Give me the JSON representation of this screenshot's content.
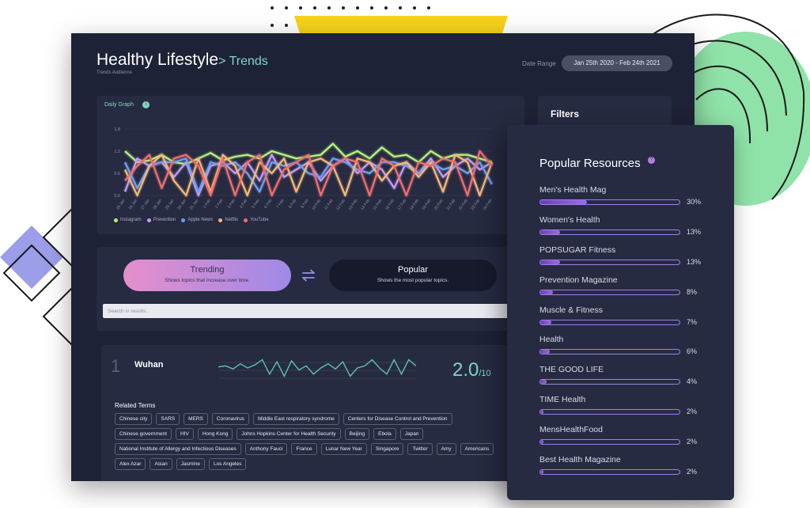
{
  "header": {
    "title": "Healthy Lifestyle",
    "crumb": "> Trends",
    "subtitle": "Trends Audience",
    "date_range_label": "Date Range",
    "date_range_value": "Jan 25th 2020 - Feb 24th 2021"
  },
  "graph": {
    "title": "Daily Graph",
    "info_icon": "info-icon",
    "legend": [
      {
        "label": "Instagram",
        "color": "#b6f07a"
      },
      {
        "label": "Prevention",
        "color": "#c49bf2"
      },
      {
        "label": "Apple News",
        "color": "#6f9ef2"
      },
      {
        "label": "Netflix",
        "color": "#f5b679"
      },
      {
        "label": "YouTube",
        "color": "#ee6e6e"
      }
    ]
  },
  "chart_data": {
    "type": "line",
    "title": "Daily Graph",
    "ylim": [
      0,
      1.8
    ],
    "yticks": [
      "0.0",
      "0.6",
      "1.2",
      "1.8"
    ],
    "x": [
      "25 Jan",
      "26 Jan",
      "27 Jan",
      "28 Jan",
      "29 Jan",
      "30 Jan",
      "31 Jan",
      "1 Feb",
      "2 Feb",
      "3 Feb",
      "4 Feb",
      "5 Feb",
      "6 Feb",
      "7 Feb",
      "8 Feb",
      "9 Feb",
      "10 Feb",
      "11 Feb",
      "12 Feb",
      "13 Feb",
      "14 Feb",
      "15 Feb",
      "16 Feb",
      "17 Feb",
      "18 Feb",
      "19 Feb",
      "20 Feb",
      "21 Feb",
      "22 Feb",
      "23 Feb",
      "24 Feb"
    ],
    "grid": true,
    "legend_placement": "bottom-left",
    "series": [
      {
        "name": "Instagram",
        "color": "#b6f07a",
        "values": [
          1.2,
          0.9,
          0.95,
          1.1,
          0.9,
          0.85,
          1.0,
          1.15,
          0.95,
          1.05,
          1.1,
          1.0,
          1.2,
          1.1,
          1.0,
          1.05,
          1.1,
          1.4,
          1.05,
          1.2,
          1.0,
          1.3,
          1.05,
          1.1,
          0.9,
          1.2,
          1.0,
          1.1,
          1.1,
          1.0,
          0.9
        ]
      },
      {
        "name": "Prevention",
        "color": "#c49bf2",
        "values": [
          0.1,
          1.0,
          0.8,
          0.9,
          0.5,
          0.9,
          0.0,
          0.8,
          0.9,
          0.6,
          0.9,
          0.4,
          1.1,
          0.5,
          0.7,
          0.9,
          0.4,
          0.8,
          1.0,
          0.6,
          0.9,
          0.7,
          0.2,
          0.9,
          0.6,
          1.0,
          0.5,
          0.8,
          1.0,
          0.7,
          0.9
        ]
      },
      {
        "name": "Apple News",
        "color": "#6f9ef2",
        "values": [
          0.9,
          0.2,
          0.8,
          0.9,
          0.9,
          1.0,
          0.1,
          0.9,
          0.8,
          0.9,
          0.6,
          0.1,
          0.9,
          0.8,
          0.9,
          0.6,
          0.5,
          1.0,
          0.9,
          0.7,
          0.6,
          0.9,
          0.9,
          0.8,
          0.6,
          0.9,
          0.7,
          0.8,
          0.6,
          0.9,
          0.3
        ]
      },
      {
        "name": "Netflix",
        "color": "#f5b679",
        "values": [
          0.7,
          0.0,
          0.8,
          1.1,
          0.4,
          0.0,
          1.0,
          0.1,
          1.1,
          0.8,
          0.0,
          0.9,
          0.6,
          1.0,
          0.1,
          0.9,
          1.0,
          0.8,
          0.0,
          1.0,
          0.9,
          0.4,
          0.8,
          0.9,
          0.5,
          0.9,
          0.1,
          1.1,
          0.9,
          0.0,
          0.9
        ]
      },
      {
        "name": "YouTube",
        "color": "#ee6e6e",
        "values": [
          0.4,
          0.8,
          1.1,
          0.2,
          1.0,
          1.1,
          0.8,
          0.0,
          1.0,
          0.0,
          0.9,
          1.1,
          0.0,
          0.7,
          0.9,
          1.1,
          0.0,
          0.8,
          1.0,
          0.9,
          0.0,
          1.0,
          0.8,
          0.0,
          0.9,
          0.8,
          1.0,
          0.9,
          0.0,
          1.2,
          0.8
        ]
      }
    ]
  },
  "filters": {
    "title": "Filters"
  },
  "toggle": {
    "trending_title": "Trending",
    "trending_desc": "Shows topics that increase over time.",
    "popular_title": "Popular",
    "popular_desc": "Shows the most popular topics.",
    "swap_icon": "swap-arrows-icon",
    "search_placeholder": "Search in results.."
  },
  "result": {
    "rank": "1",
    "name": "Wuhan",
    "score": "2.0",
    "score_den": "/10",
    "related_label": "Related Terms",
    "tags": [
      "Chinese city",
      "SARS",
      "MERS",
      "Coronavirus",
      "Middle East respiratory syndrome",
      "Centers for Disease Control and Prevention",
      "Chinese government",
      "HIV",
      "Hong Kong",
      "Johns Hopkins Center for Health Security",
      "Beijing",
      "Ebola",
      "Japan",
      "National Institute of Allergy and Infectious Diseases",
      "Anthony Fauci",
      "France",
      "Lunar New Year",
      "Singapore",
      "Twitter",
      "Amy",
      "Americans",
      "Alex Azar",
      "Asian",
      "Jasmine",
      "Los Angeles"
    ],
    "sparkline": [
      0.55,
      0.6,
      0.45,
      0.7,
      0.5,
      0.65,
      0.9,
      0.2,
      0.8,
      0.1,
      0.85,
      0.4,
      0.6,
      0.2,
      0.5,
      0.7,
      0.45,
      0.8,
      0.1,
      0.5,
      0.6,
      0.9,
      0.5,
      0.2,
      0.9,
      0.2,
      0.9,
      0.6
    ]
  },
  "popular": {
    "title": "Popular Resources",
    "info_icon": "help-icon",
    "items": [
      {
        "name": "Men's Health Mag",
        "pct_label": "30%",
        "fraction": 0.3
      },
      {
        "name": "Women's Health",
        "pct_label": "13%",
        "fraction": 0.13
      },
      {
        "name": "POPSUGAR Fitness",
        "pct_label": "13%",
        "fraction": 0.13
      },
      {
        "name": "Prevention Magazine",
        "pct_label": "8%",
        "fraction": 0.08
      },
      {
        "name": "Muscle & Fitness",
        "pct_label": "7%",
        "fraction": 0.07
      },
      {
        "name": "Health",
        "pct_label": "6%",
        "fraction": 0.06
      },
      {
        "name": "THE GOOD LIFE",
        "pct_label": "4%",
        "fraction": 0.04
      },
      {
        "name": "TIME Health",
        "pct_label": "2%",
        "fraction": 0.02
      },
      {
        "name": "MensHealthFood",
        "pct_label": "2%",
        "fraction": 0.02
      },
      {
        "name": "Best Health Magazine",
        "pct_label": "2%",
        "fraction": 0.02
      }
    ]
  }
}
